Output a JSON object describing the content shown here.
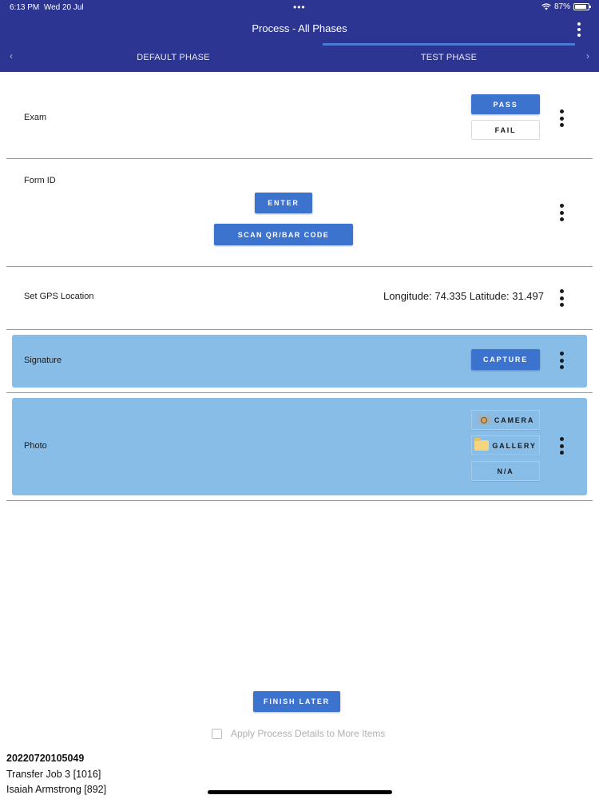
{
  "status_bar": {
    "time": "6:13 PM",
    "date": "Wed 20 Jul",
    "dots": "•••",
    "battery": "87%",
    "battery_level": 0.87
  },
  "header": {
    "title": "Process - All Phases",
    "tabs": [
      {
        "label": "DEFAULT PHASE",
        "selected": false
      },
      {
        "label": "TEST PHASE",
        "selected": true
      }
    ],
    "left_arrow": "‹",
    "right_arrow": "›"
  },
  "rows": {
    "exam": {
      "label": "Exam",
      "pass_label": "PASS",
      "fail_label": "FAIL"
    },
    "form_id": {
      "label": "Form ID",
      "enter_label": "ENTER",
      "scan_label": "SCAN QR/BAR CODE"
    },
    "gps": {
      "label": "Set GPS Location",
      "value": "Longitude: 74.335 Latitude: 31.497"
    },
    "signature": {
      "label": "Signature",
      "capture_label": "CAPTURE"
    },
    "photo": {
      "label": "Photo",
      "camera_label": "CAMERA",
      "gallery_label": "GALLERY",
      "na_label": "N/A"
    }
  },
  "footer": {
    "finish_label": "FINISH LATER",
    "apply_label": "Apply Process Details to More Items",
    "apply_checked": false,
    "item_id": "20220720105049",
    "job": "Transfer Job 3 [1016]",
    "user": "Isaiah Armstrong [892]"
  },
  "colors": {
    "header_bg": "#2c3592",
    "accent": "#3b73cf",
    "highlight_row": "#88bde8"
  },
  "icons": {
    "wifi": "wifi-icon",
    "battery": "battery-icon",
    "menu": "more-vertical-icon",
    "camera": "camera-icon",
    "gallery": "folder-icon"
  }
}
